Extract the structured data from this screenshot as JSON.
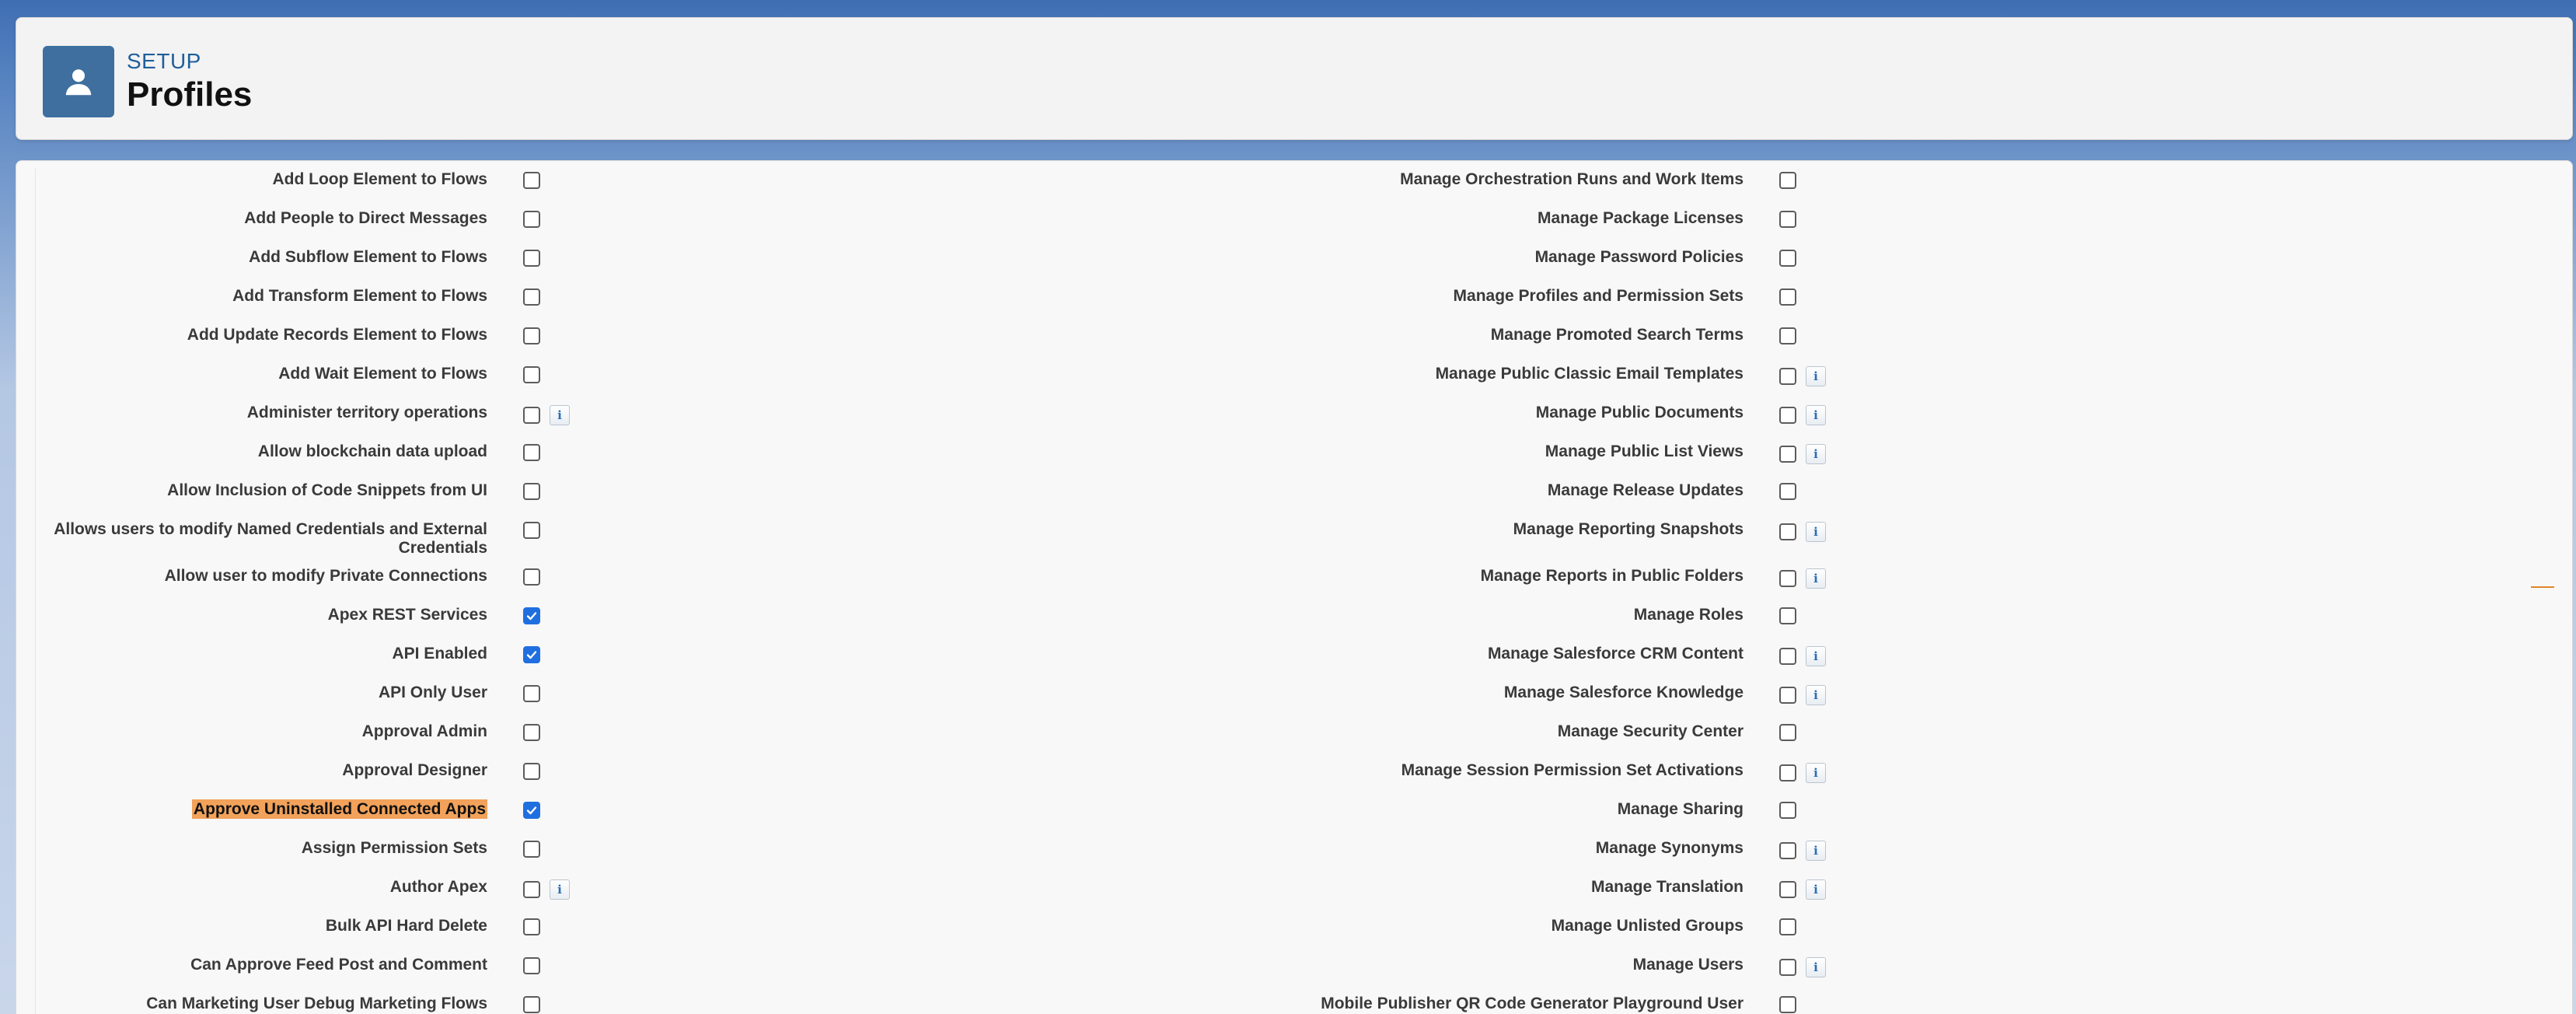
{
  "header": {
    "section": "SETUP",
    "title": "Profiles",
    "icon": "user-icon"
  },
  "left_permissions": [
    {
      "label": "Add Loop Element to Flows",
      "checked": false,
      "info": false
    },
    {
      "label": "Add People to Direct Messages",
      "checked": false,
      "info": false
    },
    {
      "label": "Add Subflow Element to Flows",
      "checked": false,
      "info": false
    },
    {
      "label": "Add Transform Element to Flows",
      "checked": false,
      "info": false
    },
    {
      "label": "Add Update Records Element to Flows",
      "checked": false,
      "info": false
    },
    {
      "label": "Add Wait Element to Flows",
      "checked": false,
      "info": false
    },
    {
      "label": "Administer territory operations",
      "checked": false,
      "info": true
    },
    {
      "label": "Allow blockchain data upload",
      "checked": false,
      "info": false
    },
    {
      "label": "Allow Inclusion of Code Snippets from UI",
      "checked": false,
      "info": false
    },
    {
      "label": "Allows users to modify Named Credentials and External Credentials",
      "checked": false,
      "info": false,
      "tall": true
    },
    {
      "label": "Allow user to modify Private Connections",
      "checked": false,
      "info": false
    },
    {
      "label": "Apex REST Services",
      "checked": true,
      "info": false
    },
    {
      "label": "API Enabled",
      "checked": true,
      "info": false
    },
    {
      "label": "API Only User",
      "checked": false,
      "info": false
    },
    {
      "label": "Approval Admin",
      "checked": false,
      "info": false
    },
    {
      "label": "Approval Designer",
      "checked": false,
      "info": false
    },
    {
      "label": "Approve Uninstalled Connected Apps",
      "checked": true,
      "info": false,
      "highlight": true
    },
    {
      "label": "Assign Permission Sets",
      "checked": false,
      "info": false
    },
    {
      "label": "Author Apex",
      "checked": false,
      "info": true
    },
    {
      "label": "Bulk API Hard Delete",
      "checked": false,
      "info": false
    },
    {
      "label": "Can Approve Feed Post and Comment",
      "checked": false,
      "info": false
    },
    {
      "label": "Can Marketing User Debug Marketing Flows",
      "checked": false,
      "info": false
    }
  ],
  "right_permissions": [
    {
      "label": "Manage Orchestration Runs and Work Items",
      "checked": false,
      "info": false
    },
    {
      "label": "Manage Package Licenses",
      "checked": false,
      "info": false
    },
    {
      "label": "Manage Password Policies",
      "checked": false,
      "info": false
    },
    {
      "label": "Manage Profiles and Permission Sets",
      "checked": false,
      "info": false
    },
    {
      "label": "Manage Promoted Search Terms",
      "checked": false,
      "info": false
    },
    {
      "label": "Manage Public Classic Email Templates",
      "checked": false,
      "info": true
    },
    {
      "label": "Manage Public Documents",
      "checked": false,
      "info": true
    },
    {
      "label": "Manage Public List Views",
      "checked": false,
      "info": true
    },
    {
      "label": "Manage Release Updates",
      "checked": false,
      "info": false
    },
    {
      "label": "Manage Reporting Snapshots",
      "checked": false,
      "info": true,
      "tall": true
    },
    {
      "label": "Manage Reports in Public Folders",
      "checked": false,
      "info": true
    },
    {
      "label": "Manage Roles",
      "checked": false,
      "info": false
    },
    {
      "label": "Manage Salesforce CRM Content",
      "checked": false,
      "info": true
    },
    {
      "label": "Manage Salesforce Knowledge",
      "checked": false,
      "info": true
    },
    {
      "label": "Manage Security Center",
      "checked": false,
      "info": false
    },
    {
      "label": "Manage Session Permission Set Activations",
      "checked": false,
      "info": true
    },
    {
      "label": "Manage Sharing",
      "checked": false,
      "info": false
    },
    {
      "label": "Manage Synonyms",
      "checked": false,
      "info": true
    },
    {
      "label": "Manage Translation",
      "checked": false,
      "info": true
    },
    {
      "label": "Manage Unlisted Groups",
      "checked": false,
      "info": false
    },
    {
      "label": "Manage Users",
      "checked": false,
      "info": true
    },
    {
      "label": "Mobile Publisher QR Code Generator Playground User",
      "checked": false,
      "info": false
    }
  ],
  "info_glyph": "i",
  "colors": {
    "accent": "#1f6fe0",
    "header_icon_bg": "#3e6f9e",
    "highlight": "#f2a25a"
  }
}
